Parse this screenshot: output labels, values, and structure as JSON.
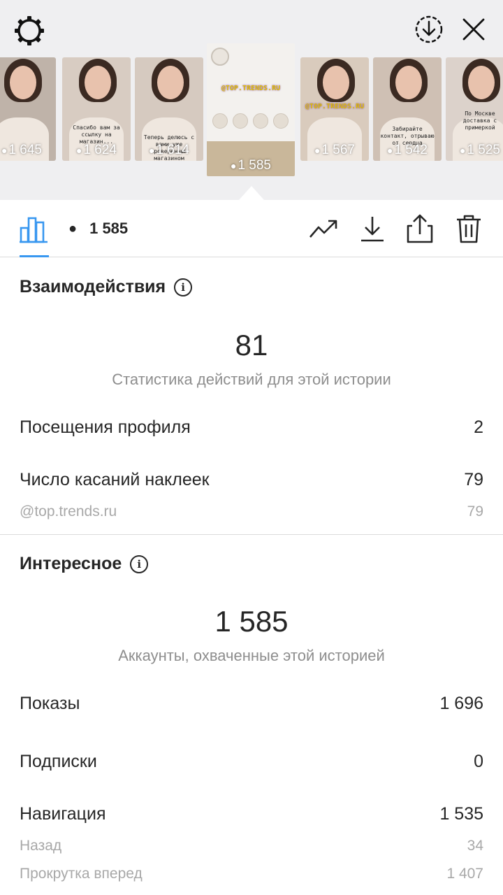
{
  "story_thumbnails": [
    {
      "views": "1 645",
      "caption": "",
      "bg": "#bfb3a9"
    },
    {
      "views": "1 624",
      "caption": "Спасибо вам за ссылку на магазин...",
      "bg": "#d8ccc2"
    },
    {
      "views": "1 614",
      "caption": "Теперь делюсь с вами уже проверенным магазином",
      "bg": "#d6cac0"
    },
    {
      "views": "1 585",
      "caption": "@TOP.TRENDS.RU",
      "bg": "#f3f1ee"
    },
    {
      "views": "1 567",
      "caption": "@TOP.TRENDS.RU",
      "bg": "#d9cbbd"
    },
    {
      "views": "1 542",
      "caption": "Забирайте контакт, отрываю от сердца",
      "bg": "#cfc0b4"
    },
    {
      "views": "1 525",
      "caption": "По Москве доставка с примеркой",
      "bg": "#dcd2cb"
    }
  ],
  "toolbar": {
    "views": "1 585",
    "chart_icon": "bar-chart-icon",
    "trend_icon": "trending-icon",
    "download_icon": "download-icon",
    "share_icon": "share-icon",
    "delete_icon": "trash-icon"
  },
  "interactions": {
    "title": "Взаимодействия",
    "total": "81",
    "total_label": "Статистика действий для этой истории",
    "rows": [
      {
        "label": "Посещения профиля",
        "value": "2"
      },
      {
        "label": "Число касаний наклеек",
        "value": "79"
      }
    ],
    "sub_rows": [
      {
        "label": "@top.trends.ru",
        "value": "79"
      }
    ]
  },
  "discovery": {
    "title": "Интересное",
    "total": "1 585",
    "total_label": "Аккаунты, охваченные этой историей",
    "rows": [
      {
        "label": "Показы",
        "value": "1 696"
      },
      {
        "label": "Подписки",
        "value": "0"
      },
      {
        "label": "Навигация",
        "value": "1 535"
      }
    ],
    "nav_sub_rows": [
      {
        "label": "Назад",
        "value": "34"
      },
      {
        "label": "Прокрутка вперед",
        "value": "1 407"
      }
    ]
  },
  "colors": {
    "accent": "#3897f0",
    "text": "#262626",
    "muted": "#8e8e8e"
  }
}
